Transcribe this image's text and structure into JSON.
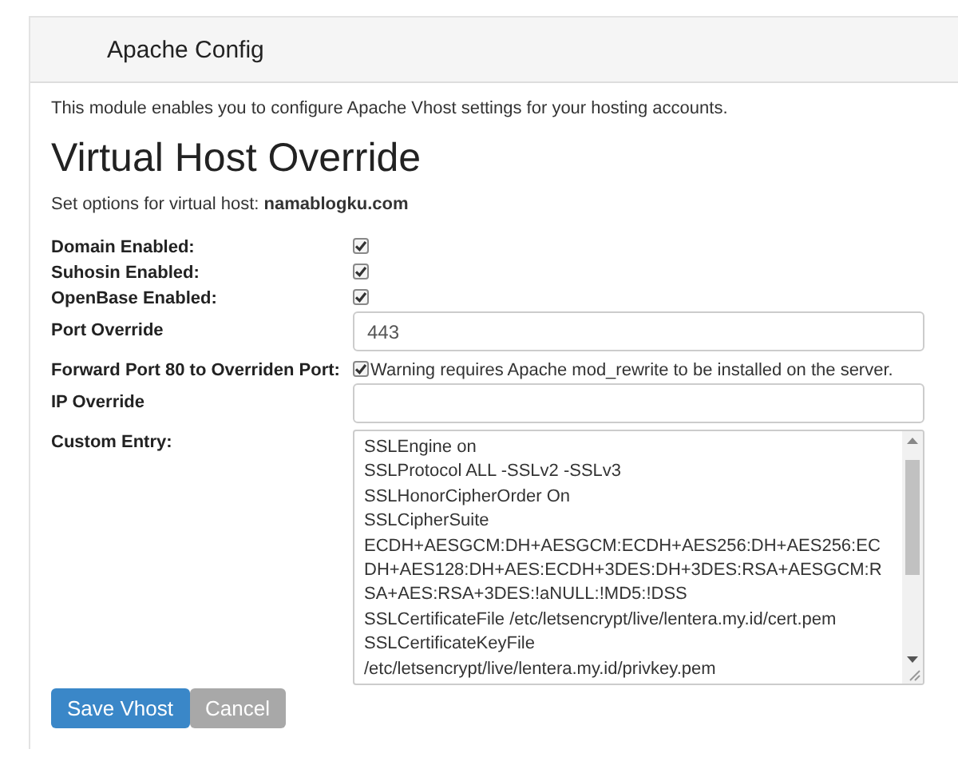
{
  "panel": {
    "title": "Apache Config"
  },
  "description": "This module enables you to configure Apache Vhost settings for your hosting accounts.",
  "heading": "Virtual Host Override",
  "host_line": {
    "label": "Set options for virtual host:",
    "host": "namablogku.com"
  },
  "fields": [
    {
      "kind": "checkbox",
      "label": "Domain Enabled:",
      "checked": true
    },
    {
      "kind": "checkbox",
      "label": "Suhosin Enabled:",
      "checked": true
    },
    {
      "kind": "checkbox",
      "label": "OpenBase Enabled:",
      "checked": true
    },
    {
      "kind": "text",
      "label": "Port Override",
      "value": "443"
    },
    {
      "kind": "checkbox",
      "label": "Forward Port 80 to Overriden Port:",
      "checked": true,
      "note": "Warning requires Apache mod_rewrite to be installed on the server."
    },
    {
      "kind": "text",
      "label": "IP Override"
    },
    {
      "kind": "textarea",
      "label": "Custom Entry:",
      "lines": [
        "SSLEngine on",
        "SSLProtocol ALL -SSLv2 -SSLv3",
        "SSLHonorCipherOrder On",
        "SSLCipherSuite",
        "ECDH+AESGCM:DH+AESGCM:ECDH+AES256:DH+AES256:ECDH+AES128:DH+AES:ECDH+3DES:DH+3DES:RSA+AESGCM:RSA+AES:RSA+3DES:!aNULL:!MD5:!DSS",
        "SSLCertificateFile /etc/letsencrypt/live/lentera.my.id/cert.pem",
        "SSLCertificateKeyFile",
        "/etc/letsencrypt/live/lentera.my.id/privkey.pem"
      ]
    }
  ],
  "buttons": [
    {
      "kind": "primary",
      "label": "Save Vhost"
    },
    {
      "kind": "secondary",
      "label": "Cancel"
    }
  ]
}
